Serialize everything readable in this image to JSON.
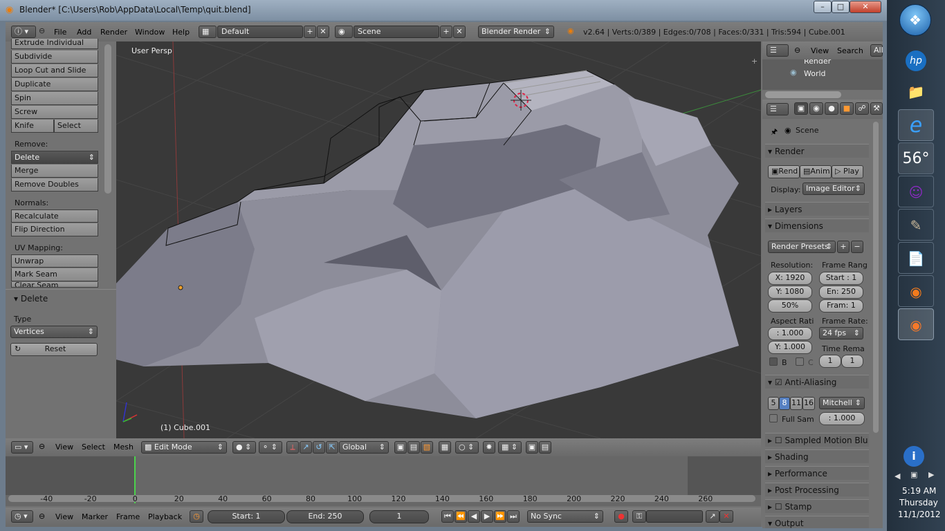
{
  "window": {
    "title": "Blender* [C:\\Users\\Rob\\AppData\\Local\\Temp\\quit.blend]",
    "min_label": "–",
    "max_label": "□",
    "close_label": "✕"
  },
  "topbar": {
    "menus": [
      "File",
      "Add",
      "Render",
      "Window",
      "Help"
    ],
    "layout": "Default",
    "scene": "Scene",
    "engine": "Blender Render",
    "stats": "v2.64 | Verts:0/389 | Edges:0/708 | Faces:0/331 | Tris:594 | Cube.001"
  },
  "outliner": {
    "menus": [
      "View",
      "Search"
    ],
    "all_label": "All",
    "items": [
      "Render",
      "World"
    ]
  },
  "toolshelf": {
    "tools": [
      "Extrude Individual",
      "Subdivide",
      "Loop Cut and Slide",
      "Duplicate",
      "Spin",
      "Screw"
    ],
    "knife": "Knife",
    "select": "Select",
    "remove_label": "Remove:",
    "remove": [
      "Delete",
      "Merge",
      "Remove Doubles"
    ],
    "normals_label": "Normals:",
    "normals": [
      "Recalculate",
      "Flip Direction"
    ],
    "uv_label": "UV Mapping:",
    "uv": [
      "Unwrap",
      "Mark Seam",
      "Clear Seam"
    ],
    "operator": {
      "title": "Delete",
      "type_label": "Type",
      "type_value": "Vertices",
      "reset": "Reset"
    }
  },
  "viewport": {
    "view_label": "User Persp",
    "object_label": "(1) Cube.001"
  },
  "view3d_header": {
    "menus": [
      "View",
      "Select",
      "Mesh"
    ],
    "mode": "Edit Mode",
    "orientation": "Global"
  },
  "properties": {
    "context": "Scene",
    "render_panel": "Render",
    "render_btn": "Rend",
    "anim_btn": "Anim",
    "play_btn": "Play",
    "display_label": "Display:",
    "display_value": "Image Editor",
    "layers_panel": "Layers",
    "dimensions_panel": "Dimensions",
    "render_presets": "Render Presets",
    "resolution_label": "Resolution:",
    "res_x": "X: 1920",
    "res_y": "Y: 1080",
    "res_pct": "50%",
    "frame_range_label": "Frame Rang",
    "start": "Start : 1",
    "end": "En: 250",
    "frame": "Fram: 1",
    "aspect_label": "Aspect Rati",
    "aspect_x": ": 1.000",
    "aspect_y": "Y: 1.000",
    "framerate_label": "Frame Rate:",
    "fps": "24 fps",
    "time_remap_label": "Time Rema",
    "remap_old": "1",
    "remap_new": "1",
    "b_label": "B",
    "c_label": "C",
    "aa_panel": "Anti-Aliasing",
    "aa_samples": [
      "5",
      "8",
      "11",
      "16"
    ],
    "aa_filter": "Mitchell",
    "full_sample": "Full Sam",
    "aa_size": ": 1.000",
    "sampled_motion": "Sampled Motion Blu",
    "shading": "Shading",
    "performance": "Performance",
    "post_processing": "Post Processing",
    "stamp": "Stamp",
    "output": "Output"
  },
  "timeline": {
    "ticks": [
      "-40",
      "-20",
      "0",
      "20",
      "40",
      "60",
      "80",
      "100",
      "120",
      "140",
      "160",
      "180",
      "200",
      "220",
      "240",
      "260"
    ],
    "menus": [
      "View",
      "Marker",
      "Frame",
      "Playback"
    ],
    "start": "Start: 1",
    "end": "End: 250",
    "current": "1",
    "sync": "No Sync"
  },
  "taskbar": {
    "weather": "56°",
    "time": "5:19 AM",
    "day": "Thursday",
    "date": "11/1/2012"
  }
}
